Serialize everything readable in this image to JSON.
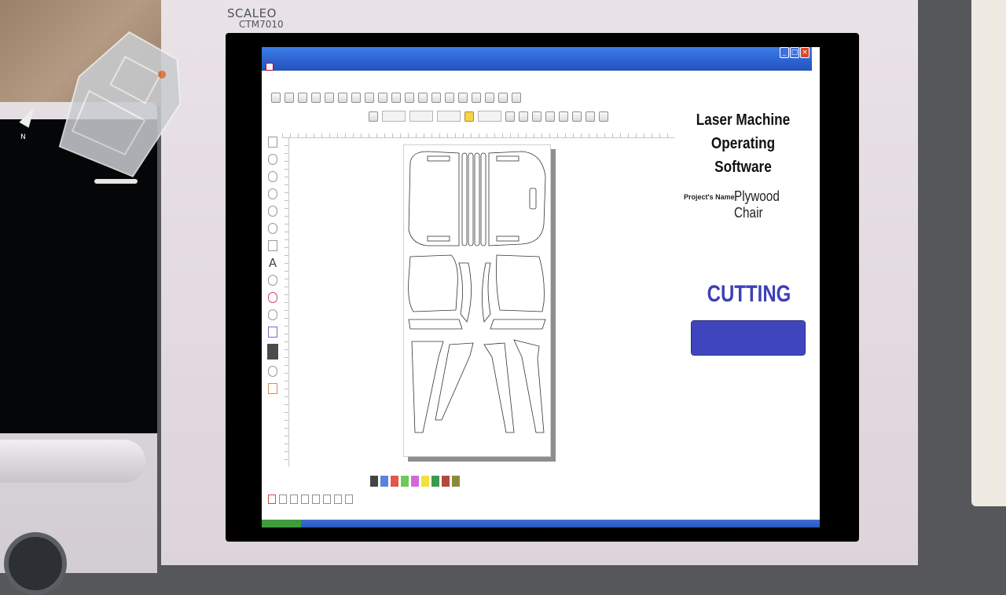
{
  "monitor": {
    "brand": "SCALEO",
    "model": "CTM7010"
  },
  "window": {
    "min_label": "_",
    "max_label": "□",
    "close_label": "×"
  },
  "left_tools": {
    "text_tool": "A"
  },
  "side_panel": {
    "title": "Laser Machine Operating Software",
    "project_label": "Project's Name:",
    "project_name": "Plywood Chair",
    "status": "CUTTING ...",
    "progress": 1.0,
    "progress_color": "#3f46bd"
  },
  "palette": {
    "colors": [
      "#444444",
      "#5b82e0",
      "#e4564b",
      "#6acb5b",
      "#d36ad6",
      "#f0e23c",
      "#3b9a4f",
      "#b04a3c",
      "#8a8a3a"
    ]
  },
  "minimap": {
    "north_label": "N"
  },
  "colors": {
    "titlebar": "#2c62cf",
    "accent_text": "#3c40b8"
  }
}
